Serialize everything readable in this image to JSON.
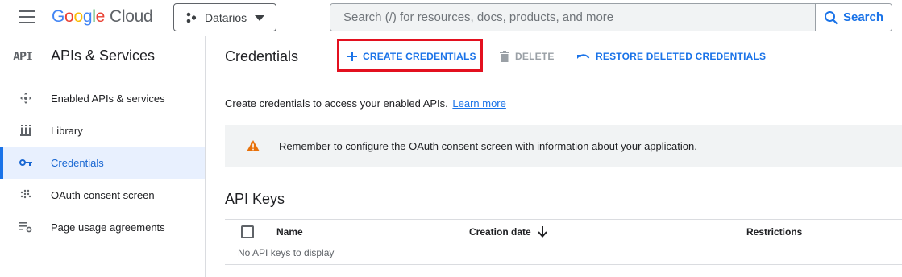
{
  "header": {
    "logo": {
      "letters": [
        "G",
        "o",
        "o",
        "g",
        "l",
        "e"
      ],
      "suffix": "Cloud"
    },
    "project_name": "Datarios",
    "search_placeholder": "Search (/) for resources, docs, products, and more",
    "search_button": "Search"
  },
  "sidebar": {
    "badge": "API",
    "title": "APIs & Services",
    "items": [
      {
        "label": "Enabled APIs & services",
        "icon": "enabled-apis-icon",
        "active": false
      },
      {
        "label": "Library",
        "icon": "library-icon",
        "active": false
      },
      {
        "label": "Credentials",
        "icon": "key-icon",
        "active": true
      },
      {
        "label": "OAuth consent screen",
        "icon": "oauth-consent-icon",
        "active": false
      },
      {
        "label": "Page usage agreements",
        "icon": "settings-list-icon",
        "active": false
      }
    ]
  },
  "main": {
    "title": "Credentials",
    "actions": {
      "create": "CREATE CREDENTIALS",
      "delete": "DELETE",
      "restore": "RESTORE DELETED CREDENTIALS"
    },
    "intro_text": "Create credentials to access your enabled APIs.",
    "learn_more": "Learn more",
    "banner_text": "Remember to configure the OAuth consent screen with information about your application.",
    "api_keys": {
      "title": "API Keys",
      "columns": [
        "Name",
        "Creation date",
        "Restrictions"
      ],
      "empty_text": "No API keys to display"
    }
  },
  "colors": {
    "accent": "#1a73e8",
    "highlight_box": "#e3101f",
    "warning": "#e8710a",
    "active_bg": "#e8f0fe"
  }
}
